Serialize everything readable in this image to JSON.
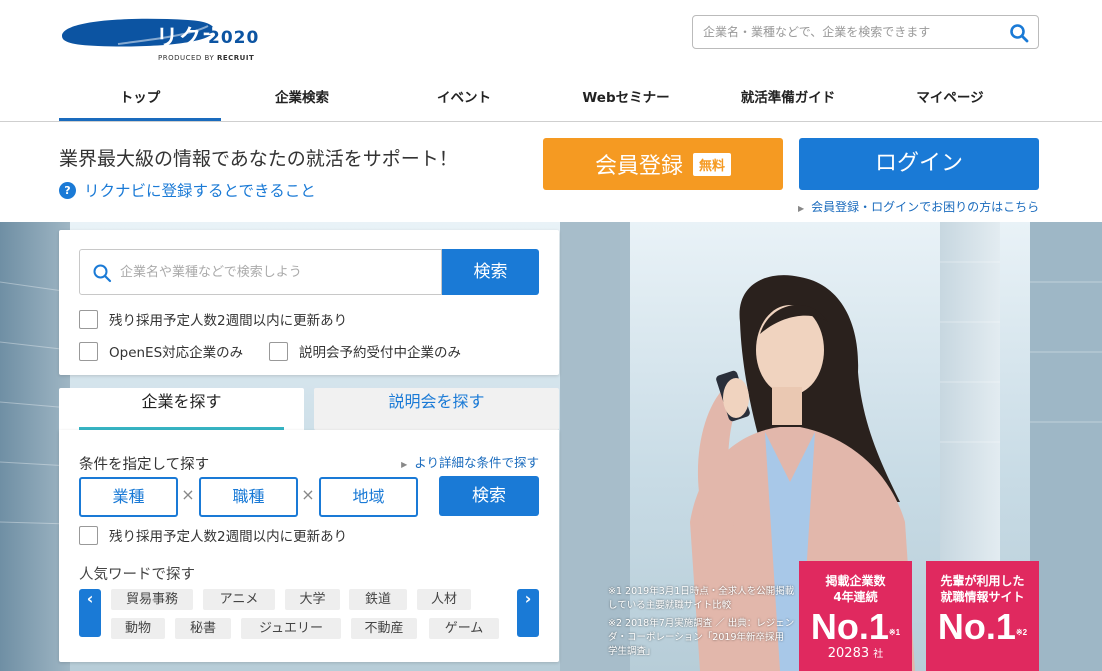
{
  "header": {
    "logo_text": "リクナビ",
    "logo_year": "2020",
    "logo_sub": "PRODUCED BY",
    "logo_sub_brand": "RECRUIT",
    "search_placeholder": "企業名・業種などで、企業を検索できます"
  },
  "nav": {
    "items": [
      "トップ",
      "企業検索",
      "イベント",
      "Webセミナー",
      "就活準備ガイド",
      "マイページ"
    ],
    "active_index": 0
  },
  "promo": {
    "tagline": "業界最大級の情報であなたの就活をサポート！",
    "help_text": "リクナビに登録するとできること",
    "register_label": "会員登録",
    "register_badge": "無料",
    "login_label": "ログイン",
    "help_link": "会員登録・ログインでお困りの方はこちら"
  },
  "keyword_search": {
    "placeholder": "企業名や業種などで検索しよう",
    "button": "検索",
    "checkboxes": [
      "残り採用予定人数2週間以内に更新あり",
      "OpenES対応企業のみ",
      "説明会予約受付中企業のみ"
    ]
  },
  "tabs": [
    "企業を探す",
    "説明会を探す"
  ],
  "condition_search": {
    "title": "条件を指定して探す",
    "detail_link": "より詳細な条件で探す",
    "chips": [
      "業種",
      "職種",
      "地域"
    ],
    "separator": "×",
    "button": "検索",
    "checkbox": "残り採用予定人数2週間以内に更新あり"
  },
  "popular": {
    "title": "人気ワードで探す",
    "prev": "‹",
    "next": "›",
    "row1": [
      "貿易事務",
      "アニメ",
      "大学",
      "鉄道",
      "人材"
    ],
    "row2": [
      "動物",
      "秘書",
      "ジュエリー",
      "不動産",
      "ゲーム"
    ]
  },
  "notes": [
    "※1 2019年3月1日時点・全求人を公開掲載している主要就職サイト比較",
    "※2 2018年7月実施調査 ／ 出典：レジェンダ・コーポレーション「2019年新卒採用 学生調査」"
  ],
  "badges": [
    {
      "title": "掲載企業数\n4年連続",
      "big": "No.1",
      "mark": "※1",
      "count": "20283",
      "unit": "社",
      "color": "#e0295f"
    },
    {
      "title": "先輩が利用した\n就職情報サイト",
      "big": "No.1",
      "mark": "※2",
      "color": "#e0295f"
    }
  ],
  "colors": {
    "brand_blue": "#1a7ad6",
    "register_orange": "#f59a22",
    "badge_pink": "#e0295f",
    "tab_underline": "#36b4c3"
  }
}
